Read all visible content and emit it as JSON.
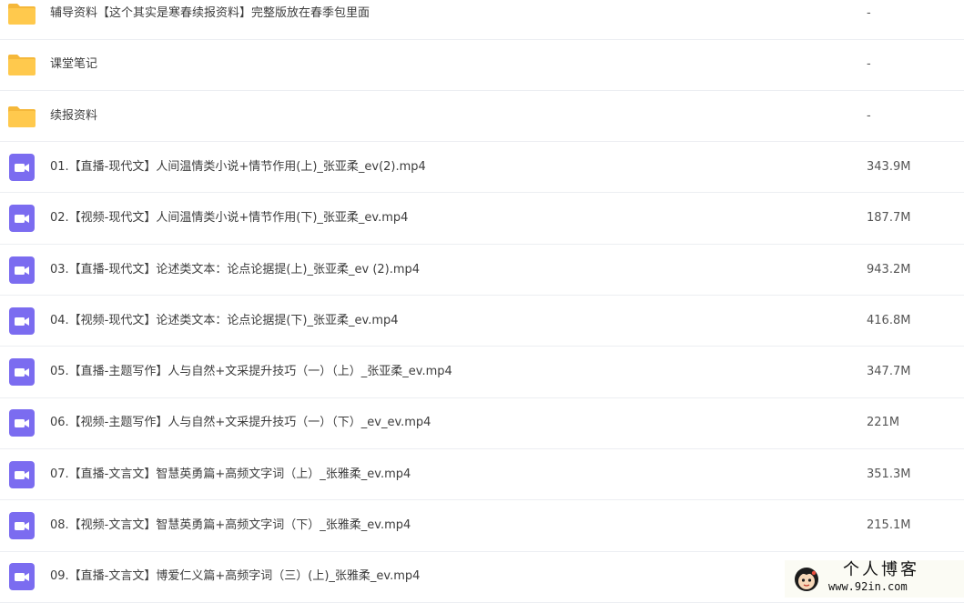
{
  "files": [
    {
      "type": "folder",
      "icon": "folder-icon",
      "name": "辅导资料【这个其实是寒春续报资料】完整版放在春季包里面",
      "size": "-"
    },
    {
      "type": "folder",
      "icon": "folder-icon",
      "name": "课堂笔记",
      "size": "-"
    },
    {
      "type": "folder",
      "icon": "folder-icon",
      "name": "续报资料",
      "size": "-"
    },
    {
      "type": "video",
      "icon": "video-file-icon",
      "name": "01.【直播-现代文】人间温情类小说+情节作用(上)_张亚柔_ev(2).mp4",
      "size": "343.9M"
    },
    {
      "type": "video",
      "icon": "video-file-icon",
      "name": "02.【视频-现代文】人间温情类小说+情节作用(下)_张亚柔_ev.mp4",
      "size": "187.7M"
    },
    {
      "type": "video",
      "icon": "video-file-icon",
      "name": "03.【直播-现代文】论述类文本：论点论据提(上)_张亚柔_ev (2).mp4",
      "size": "943.2M"
    },
    {
      "type": "video",
      "icon": "video-file-icon",
      "name": "04.【视频-现代文】论述类文本：论点论据提(下)_张亚柔_ev.mp4",
      "size": "416.8M"
    },
    {
      "type": "video",
      "icon": "video-file-icon",
      "name": "05.【直播-主题写作】人与自然+文采提升技巧（一）（上）_张亚柔_ev.mp4",
      "size": "347.7M"
    },
    {
      "type": "video",
      "icon": "video-file-icon",
      "name": "06.【视频-主题写作】人与自然+文采提升技巧（一）（下）_ev_ev.mp4",
      "size": "221M"
    },
    {
      "type": "video",
      "icon": "video-file-icon",
      "name": "07.【直播-文言文】智慧英勇篇+高频文字词（上）_张雅柔_ev.mp4",
      "size": "351.3M"
    },
    {
      "type": "video",
      "icon": "video-file-icon",
      "name": "08.【视频-文言文】智慧英勇篇+高频文字词（下）_张雅柔_ev.mp4",
      "size": "215.1M"
    },
    {
      "type": "video",
      "icon": "video-file-icon",
      "name": "09.【直播-文言文】博爱仁义篇+高频字词（三）(上)_张雅柔_ev.mp4",
      "size": ""
    }
  ],
  "watermark": {
    "title": "个人博客",
    "url": "www.92in.com",
    "avatar_icon": "cartoon-avatar-icon"
  },
  "colors": {
    "folder": "#ffc94d",
    "video_icon": "#7b6cf0",
    "divider": "#eceef2"
  }
}
